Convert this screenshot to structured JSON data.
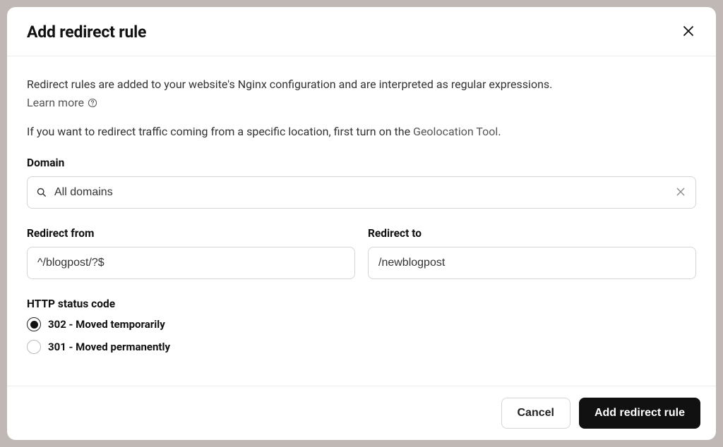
{
  "modal": {
    "title": "Add redirect rule",
    "intro": "Redirect rules are added to your website's Nginx configuration and are interpreted as regular expressions.",
    "learn_more": "Learn more",
    "geo_prefix": "If you want to redirect traffic coming from a specific location, first turn on the ",
    "geo_link": "Geolocation Tool",
    "geo_suffix": "."
  },
  "fields": {
    "domain_label": "Domain",
    "domain_value": "All domains",
    "redirect_from_label": "Redirect from",
    "redirect_from_value": "^/blogpost/?$",
    "redirect_to_label": "Redirect to",
    "redirect_to_value": "/newblogpost",
    "status_code_label": "HTTP status code"
  },
  "radios": {
    "option_302": "302 - Moved temporarily",
    "option_301": "301 - Moved permanently",
    "selected": "302"
  },
  "footer": {
    "cancel": "Cancel",
    "submit": "Add redirect rule"
  }
}
